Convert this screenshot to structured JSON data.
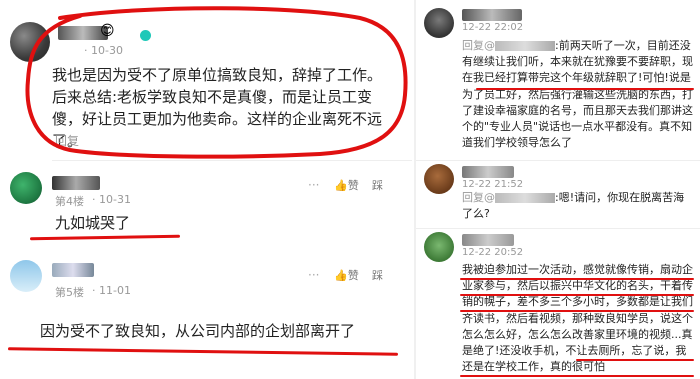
{
  "left": {
    "c1": {
      "time": "· 10-30",
      "text": "我也是因为受不了原单位搞致良知，辞掉了工作。后来总结:老板学致良知不是真傻，而是让员工变傻，好让员工更加为他卖命。这样的企业离死不远了。",
      "reply": "回复"
    },
    "c2": {
      "floor": "第4楼",
      "time": "· 10-31",
      "like": "赞",
      "dislike": "踩",
      "text": "九如城哭了"
    },
    "c3": {
      "floor": "第5楼",
      "time": "· 11-01",
      "like": "赞",
      "dislike": "踩",
      "text": "因为受不了致良知，从公司内部的企划部离开了"
    }
  },
  "right": {
    "r1": {
      "time": "12-22 22:02",
      "reply_prefix": "回复@",
      "text": ":前两天听了一次，目前还没有继续让我们听，本来就在犹豫要不要辞职，现在我已经打算带完这个年级就辞职了!可怕!说是为了员工好，然后强行灌输这些洗脑的东西，打了建设幸福家庭的名号，而且那天去我们那讲这个的\"专业人员\"说话也一点水平都没有。真不知道我们学校领导怎么了"
    },
    "r2": {
      "time": "12-22 21:52",
      "reply_prefix": "回复@",
      "text": ":嗯!请问，你现在脱离苦海了么?"
    },
    "r3": {
      "time": "12-22 20:52",
      "text": "我被迫参加过一次活动，感觉就像传销，扇动企业家参与，然后以振兴中华文化的名头，干着传销的幌子，差不多三个多小时，多数都是让我们齐读书，然后看视频，那种致良知学员，说这个怎么怎么好，怎么怎么改善家里环境的视频...真是绝了!还没收手机，不让去厕所，忘了说，我还是在学校工作，真的很可怕"
    }
  },
  "colors": {
    "annotation": "#e01010",
    "link": "#2f5fa7",
    "meta": "#999999"
  }
}
